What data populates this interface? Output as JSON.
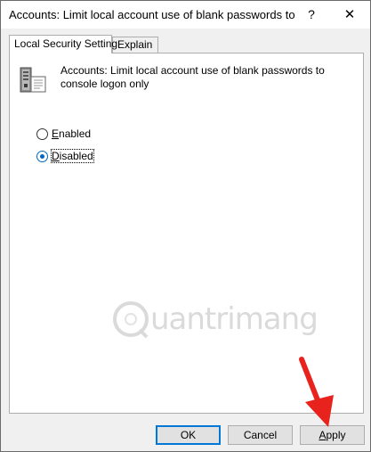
{
  "window": {
    "title": "Accounts: Limit local account use of blank passwords to c...",
    "help_glyph": "?",
    "close_glyph": "✕"
  },
  "tabs": [
    {
      "label": "Local Security Setting",
      "active": true
    },
    {
      "label": "Explain",
      "active": false
    }
  ],
  "policy": {
    "description": "Accounts: Limit local account use of blank passwords to console logon only",
    "icon": "server-icon"
  },
  "options": [
    {
      "label": "Enabled",
      "selected": false
    },
    {
      "label": "Disabled",
      "selected": true
    }
  ],
  "watermark": {
    "text": "uantrimang"
  },
  "buttons": {
    "ok": "OK",
    "cancel": "Cancel",
    "apply": "Apply"
  },
  "colors": {
    "accent": "#0078d7",
    "annotation_arrow": "#e8231e"
  }
}
